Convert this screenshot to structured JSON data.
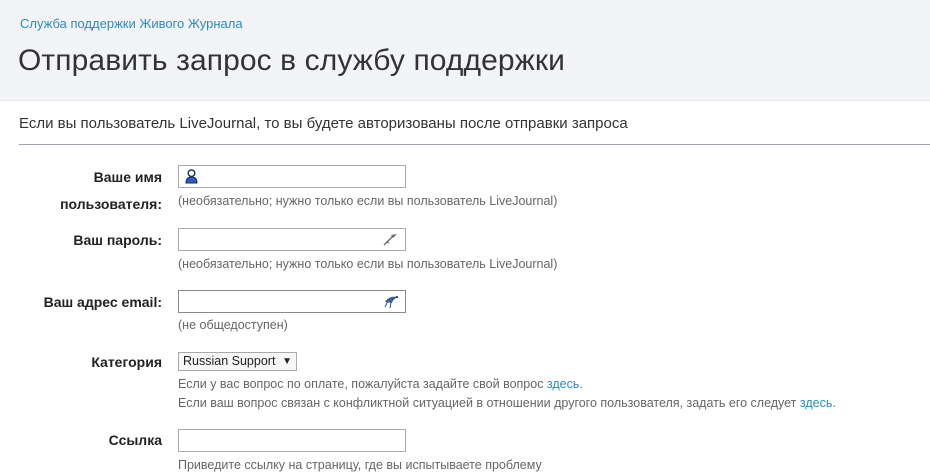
{
  "header": {
    "breadcrumb": "Служба поддержки Живого Журнала",
    "title": "Отправить запрос в службу поддержки"
  },
  "intro": "Если вы пользователь LiveJournal, то вы будете авторизованы после отправки запроса",
  "form": {
    "username": {
      "label_line1": "Ваше имя",
      "label_line2": "пользователя:",
      "value": "",
      "hint": "(необязательно; нужно только если вы пользователь LiveJournal)",
      "icon": "user-icon"
    },
    "password": {
      "label": "Ваш пароль:",
      "value": "",
      "hint": "(необязательно; нужно только если вы пользователь LiveJournal)",
      "icon": "key-icon"
    },
    "email": {
      "label": "Ваш адрес email:",
      "value": "",
      "hint": "(не общедоступен)",
      "icon": "bird-icon"
    },
    "category": {
      "label": "Категория",
      "selected": "Russian Support",
      "hint1_text": "Если у вас вопрос по оплате, пожалуйста задайте свой вопрос ",
      "hint1_link": "здесь",
      "hint1_end": ".",
      "hint2_text": "Если ваш вопрос связан с конфликтной ситуацией в отношении другого пользователя, задать его следует ",
      "hint2_link": "здесь",
      "hint2_end": "."
    },
    "link": {
      "label": "Ссылка",
      "value": "",
      "hint": "Приведите ссылку на страницу, где вы испытываете проблему"
    }
  },
  "colors": {
    "link": "#2a8bbf",
    "header_bg": "#f2f4f7",
    "text": "#333333",
    "hint": "#666666"
  }
}
